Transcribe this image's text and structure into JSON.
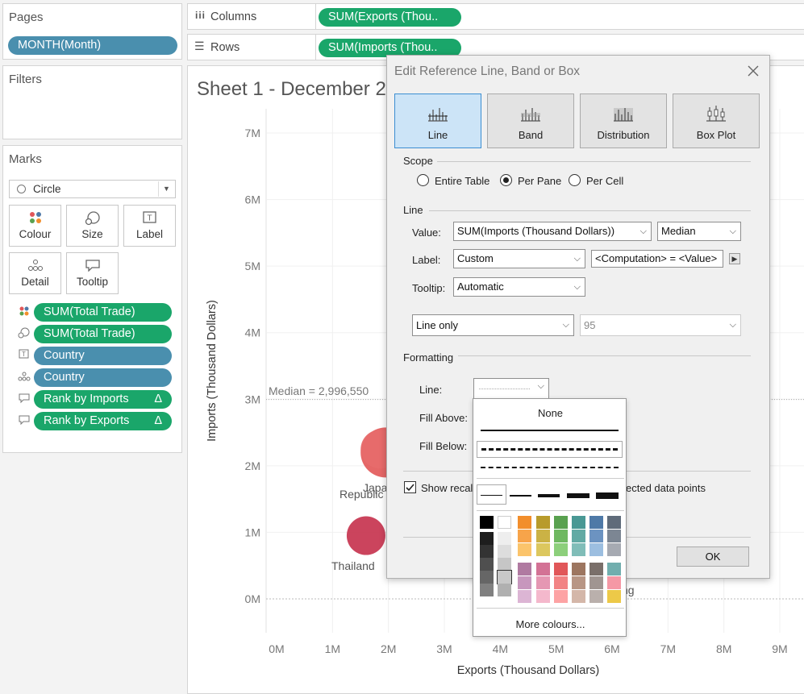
{
  "shelves": {
    "pages_title": "Pages",
    "pages_pill": "MONTH(Month)",
    "filters_title": "Filters",
    "columns_label": "Columns",
    "columns_pill": "SUM(Exports (Thou..",
    "rows_label": "Rows",
    "rows_pill": "SUM(Imports (Thou.."
  },
  "marks": {
    "title": "Marks",
    "type": "Circle",
    "buttons": [
      "Colour",
      "Size",
      "Label",
      "Detail",
      "Tooltip"
    ],
    "pills": [
      {
        "label": "SUM(Total Trade)",
        "icon": "colour-icon",
        "color": "green",
        "delta": ""
      },
      {
        "label": "SUM(Total Trade)",
        "icon": "size-icon",
        "color": "green",
        "delta": ""
      },
      {
        "label": "Country",
        "icon": "label-icon",
        "color": "blue",
        "delta": ""
      },
      {
        "label": "Country",
        "icon": "detail-icon",
        "color": "blue",
        "delta": ""
      },
      {
        "label": "Rank by Imports",
        "icon": "tooltip-icon",
        "color": "green",
        "delta": "Δ"
      },
      {
        "label": "Rank by Exports",
        "icon": "tooltip-icon",
        "color": "green",
        "delta": "Δ"
      }
    ]
  },
  "sheet": {
    "title": "Sheet 1 - December 2",
    "median_label": "Median = 2,996,550",
    "labels": {
      "japan": "Japa",
      "republic": "Republic",
      "thailand": "Thailand",
      "hongkong": "ng"
    }
  },
  "chart_data": {
    "type": "scatter",
    "xlabel": "Exports (Thousand Dollars)",
    "ylabel": "Imports (Thousand Dollars)",
    "x_ticks": [
      "0M",
      "1M",
      "2M",
      "3M",
      "4M",
      "5M",
      "6M",
      "7M",
      "8M",
      "9M"
    ],
    "y_ticks": [
      "0M",
      "1M",
      "2M",
      "3M",
      "4M",
      "5M",
      "6M",
      "7M"
    ],
    "xlim": [
      0,
      9000000
    ],
    "ylim": [
      0,
      7000000
    ],
    "reference_line": {
      "type": "median",
      "value": 2996550
    },
    "points": [
      {
        "label": "Japan",
        "x": 1950000,
        "y": 2200000,
        "color": "#e35a5a"
      },
      {
        "label": "Republic",
        "x": 1850000,
        "y": 2250000,
        "color": "#e76b6b"
      },
      {
        "label": "Thailand",
        "x": 1600000,
        "y": 950000,
        "color": "#c7344f"
      }
    ]
  },
  "dialog": {
    "title": "Edit Reference Line, Band or Box",
    "tabs": [
      "Line",
      "Band",
      "Distribution",
      "Box Plot"
    ],
    "scope_label": "Scope",
    "scope_options": [
      "Entire Table",
      "Per Pane",
      "Per Cell"
    ],
    "line_section": "Line",
    "value_label": "Value:",
    "value_field": "SUM(Imports (Thousand Dollars))",
    "value_agg": "Median",
    "label_label": "Label:",
    "label_value": "Custom",
    "label_text": "<Computation> = <Value>",
    "tooltip_label": "Tooltip:",
    "tooltip_value": "Automatic",
    "ci_value": "Line only",
    "ci_percent": "95",
    "formatting_label": "Formatting",
    "line_fmt_label": "Line:",
    "fill_above_label": "Fill Above:",
    "fill_below_label": "Fill Below:",
    "show_recalc_part1": "Show recalc",
    "show_recalc_part2": "ected data points",
    "ok_label": "OK"
  },
  "dropdown": {
    "none_label": "None",
    "more_colours": "More colours...",
    "palette_rows": [
      [
        "#f28e2b",
        "#b89b2b",
        "#59a14f",
        "#499894",
        "#4e79a7",
        "#5f6b7a"
      ],
      [
        "#f7a44a",
        "#cbb245",
        "#6fb861",
        "#62aaa4",
        "#6c93c1",
        "#7c8693"
      ],
      [
        "#fbc46b",
        "#dcc75e",
        "#8ccf7b",
        "#80bdb8",
        "#9cbee0",
        "#a6aab2"
      ],
      [
        "#b07aa1",
        "#d37295",
        "#e15759",
        "#9d7660",
        "#7a6f6a",
        "#71aeae"
      ],
      [
        "#c797bd",
        "#e597b3",
        "#f28384",
        "#b89685",
        "#a09591",
        "#f598a5"
      ],
      [
        "#dcb5d4",
        "#f4b8cc",
        "#fda3a4",
        "#d4b7a9",
        "#bab0ac",
        "#edc948"
      ]
    ],
    "gray_col1": [
      "#000000",
      "#1e1e1e",
      "#333333",
      "#4f4f4f",
      "#666666",
      "#808080"
    ],
    "gray_col2": [
      "#ffffff",
      "#eeeeee",
      "#dddddd",
      "#c6c6c6",
      "#c8c8c8",
      "#b0b0b0"
    ]
  }
}
